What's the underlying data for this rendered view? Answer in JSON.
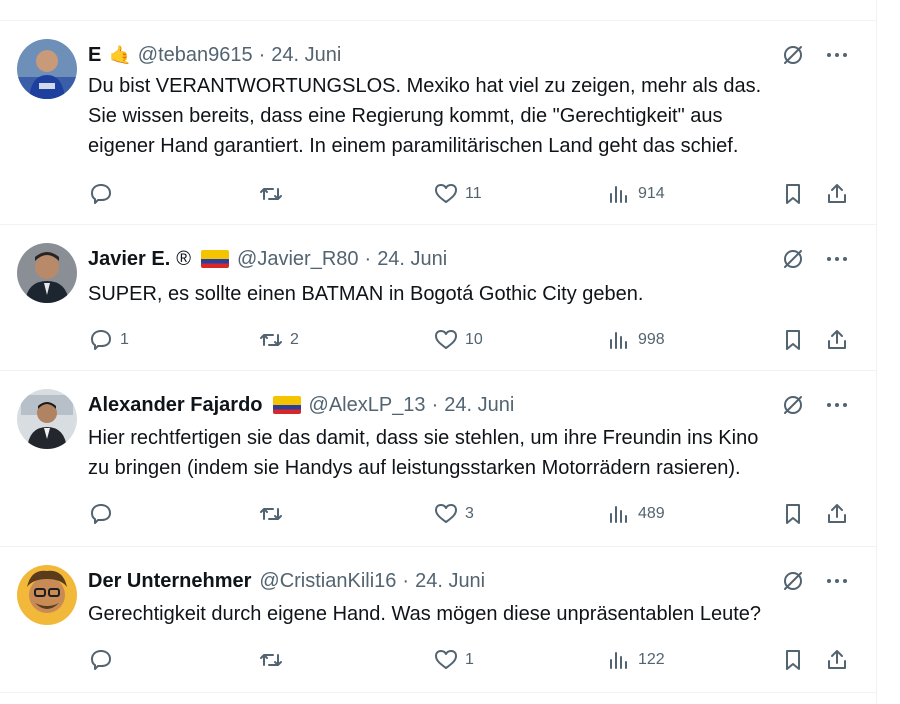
{
  "tweets": [
    {
      "name": "E",
      "badge": "🤙",
      "handle": "@teban9615",
      "dot": "·",
      "date": "24. Juni",
      "text": "Du bist VERANTWORTUNGSLOS. Mexiko hat viel zu zeigen, mehr als das.\nSie wissen bereits, dass eine Regierung kommt, die \"Gerechtigkeit\" aus\neigener Hand garantiert. In einem paramilitärischen Land geht das schief.",
      "replies": "",
      "retweets": "",
      "likes": "11",
      "views": "914"
    },
    {
      "name": "Javier E.",
      "reg": "®",
      "handle": "@Javier_R80",
      "dot": "·",
      "date": "24. Juni",
      "text": "SUPER, es sollte einen BATMAN in Bogotá Gothic City geben.",
      "replies": "1",
      "retweets": "2",
      "likes": "10",
      "views": "998"
    },
    {
      "name": "Alexander Fajardo",
      "handle": "@AlexLP_13",
      "dot": "·",
      "date": "24. Juni",
      "text": "Hier rechtfertigen sie das damit, dass sie stehlen, um ihre Freundin ins Kino\nzu bringen (indem sie Handys auf leistungsstarken Motorrädern rasieren).",
      "replies": "",
      "retweets": "",
      "likes": "3",
      "views": "489"
    },
    {
      "name": "Der Unternehmer",
      "handle": "@CristianKili16",
      "dot": "·",
      "date": "24. Juni",
      "text": "Gerechtigkeit durch eigene Hand. Was mögen diese unpräsentablen Leute?",
      "replies": "",
      "retweets": "",
      "likes": "1",
      "views": "122"
    }
  ],
  "icons": {
    "reply": "reply-icon",
    "retweet": "retweet-icon",
    "like": "heart-icon",
    "views": "views-icon",
    "bookmark": "bookmark-icon",
    "share": "share-icon",
    "grok": "grok-icon",
    "more": "more-icon"
  },
  "colors": {
    "secondary_text": "#536471",
    "border": "#eff3f4",
    "flag_colombia": [
      "#f4c400",
      "#2c3e9b",
      "#d62828"
    ]
  }
}
